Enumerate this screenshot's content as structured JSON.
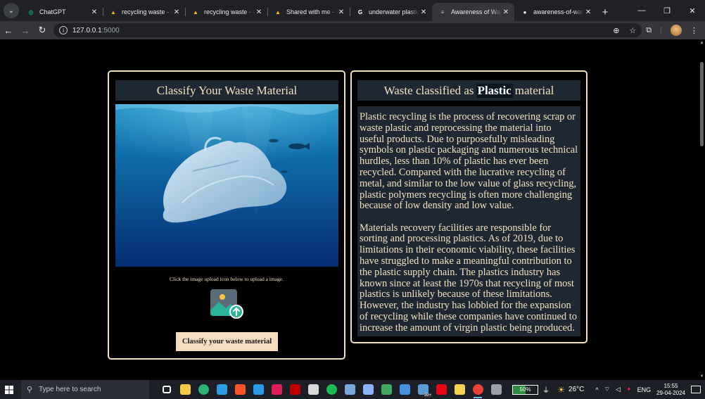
{
  "browser": {
    "tabs": [
      {
        "title": "ChatGPT",
        "icon": "chatgpt-icon",
        "color": "#10a37f",
        "glyph": "◎",
        "active": false
      },
      {
        "title": "recycling waste - Goo",
        "icon": "google-drive-icon",
        "color": "#fbbc04",
        "glyph": "▲",
        "active": false
      },
      {
        "title": "recycling waste - Goo",
        "icon": "google-drive-icon",
        "color": "#fbbc04",
        "glyph": "▲",
        "active": false
      },
      {
        "title": "Shared with me - Goo",
        "icon": "google-drive-icon",
        "color": "#fbbc04",
        "glyph": "▲",
        "active": false
      },
      {
        "title": "underwater plastic pol",
        "icon": "google-icon",
        "color": "#ffffff",
        "glyph": "G",
        "active": false
      },
      {
        "title": "Awareness of Waste",
        "icon": "page-icon",
        "color": "#bdc1c6",
        "glyph": "≡",
        "active": true
      },
      {
        "title": "awareness-of-waste",
        "icon": "github-icon",
        "color": "#ffffff",
        "glyph": "●",
        "active": false
      }
    ],
    "url_host": "127.0.0.1",
    "url_port": ":5000"
  },
  "left_card": {
    "title": "Classify Your Waste Material",
    "hint": "Click the image upload icon below to upload a image.",
    "button_label": "Classify your waste material"
  },
  "right_card": {
    "title_prefix": "Waste classified as",
    "title_highlight": "Plastic",
    "title_suffix": "material",
    "paragraphs": [
      "Plastic recycling is the process of recovering scrap or waste plastic and reprocessing the material into useful products. Due to purposefully misleading symbols on plastic packaging and numerous technical hurdles, less than 10% of plastic has ever been recycled. Compared with the lucrative recycling of metal, and similar to the low value of glass recycling, plastic polymers recycling is often more challenging because of low density and low value.",
      "Materials recovery facilities are responsible for sorting and processing plastics. As of 2019, due to limitations in their economic viability, these facilities have struggled to make a meaningful contribution to the plastic supply chain. The plastics industry has known since at least the 1970s that recycling of most plastics is unlikely because of these limitations. However, the industry has lobbied for the expansion of recycling while these companies have continued to increase the amount of virgin plastic being produced."
    ]
  },
  "taskbar": {
    "search_placeholder": "Type here to search",
    "apps": [
      {
        "name": "task-view-icon",
        "color": "#ffffff"
      },
      {
        "name": "file-explorer-icon",
        "color": "#f7c948"
      },
      {
        "name": "edge-icon",
        "color": "#2bb673"
      },
      {
        "name": "store-icon",
        "color": "#2f9be0"
      },
      {
        "name": "brave-icon",
        "color": "#fb542b"
      },
      {
        "name": "vscode-icon",
        "color": "#2a9bea"
      },
      {
        "name": "slack-icon",
        "color": "#e01e5a"
      },
      {
        "name": "filezilla-icon",
        "color": "#bf0000"
      },
      {
        "name": "app-icon",
        "color": "#d9d9d9"
      },
      {
        "name": "spotify-icon",
        "color": "#1db954"
      },
      {
        "name": "app-icon",
        "color": "#7aa7d9"
      },
      {
        "name": "app-icon",
        "color": "#8ab4f8"
      },
      {
        "name": "photos-icon",
        "color": "#41a85f"
      },
      {
        "name": "app-icon",
        "color": "#4a90e2"
      },
      {
        "name": "app-icon",
        "color": "#5b9bd5"
      },
      {
        "name": "netflix-icon",
        "color": "#e50914"
      },
      {
        "name": "sticky-notes-icon",
        "color": "#f7d154"
      },
      {
        "name": "chrome-icon",
        "color": "#ea4335"
      },
      {
        "name": "app-icon",
        "color": "#9aa0a6"
      }
    ],
    "badge": "99+",
    "battery": "50%",
    "temperature": "26°C",
    "language": "ENG",
    "time": "15:55",
    "date": "29-04-2024"
  }
}
